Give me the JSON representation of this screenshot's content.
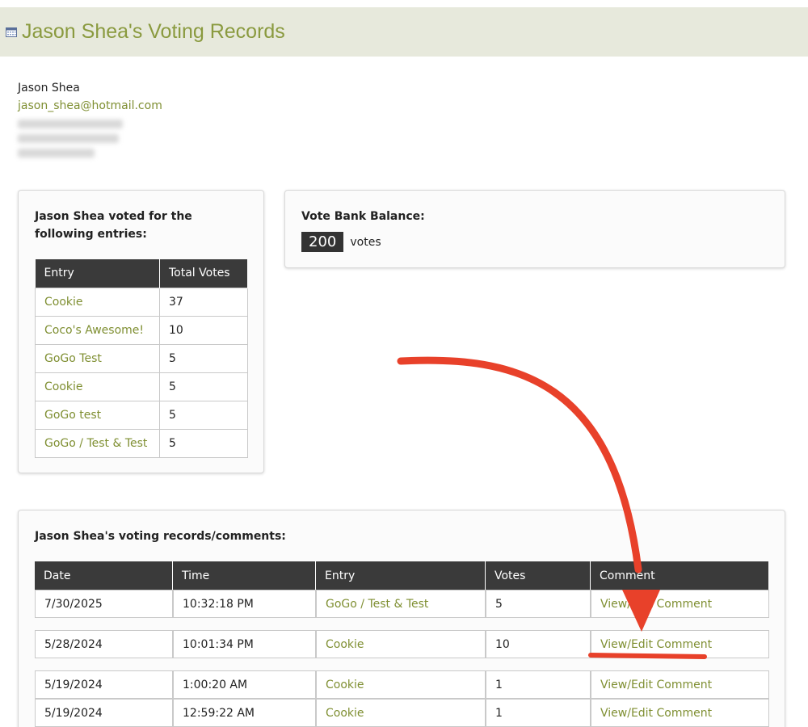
{
  "header": {
    "title": "Jason Shea's Voting Records",
    "icon": "calendar-icon"
  },
  "user": {
    "name": "Jason Shea",
    "email": "jason_shea@hotmail.com"
  },
  "entries_card": {
    "heading": "Jason Shea voted for the following entries:",
    "columns": [
      "Entry",
      "Total Votes"
    ],
    "rows": [
      {
        "entry": "Cookie",
        "votes": "37"
      },
      {
        "entry": "Coco's Awesome!",
        "votes": "10"
      },
      {
        "entry": "GoGo Test",
        "votes": "5"
      },
      {
        "entry": "Cookie",
        "votes": "5"
      },
      {
        "entry": "GoGo test",
        "votes": "5"
      },
      {
        "entry": "GoGo / Test & Test",
        "votes": "5"
      }
    ]
  },
  "balance_card": {
    "heading": "Vote Bank Balance:",
    "amount": "200",
    "unit": "votes"
  },
  "records_card": {
    "heading": "Jason Shea's voting records/comments:",
    "columns": [
      "Date",
      "Time",
      "Entry",
      "Votes",
      "Comment"
    ],
    "rows": [
      {
        "date": "7/30/2025",
        "time": "10:32:18 PM",
        "entry": "GoGo / Test & Test",
        "votes": "5",
        "comment": "View/Edit Comment"
      },
      {
        "date": "5/28/2024",
        "time": "10:01:34 PM",
        "entry": "Cookie",
        "votes": "10",
        "comment": "View/Edit Comment"
      },
      {
        "date": "5/19/2024",
        "time": "1:00:20 AM",
        "entry": "Cookie",
        "votes": "1",
        "comment": "View/Edit Comment"
      },
      {
        "date": "5/19/2024",
        "time": "12:59:22 AM",
        "entry": "Cookie",
        "votes": "1",
        "comment": "View/Edit Comment"
      }
    ]
  },
  "annotation": {
    "arrow_color": "#e8412a"
  },
  "colors": {
    "accent": "#7f8f32",
    "header_bg": "#e7e9dc",
    "table_header": "#3a3a3a"
  }
}
